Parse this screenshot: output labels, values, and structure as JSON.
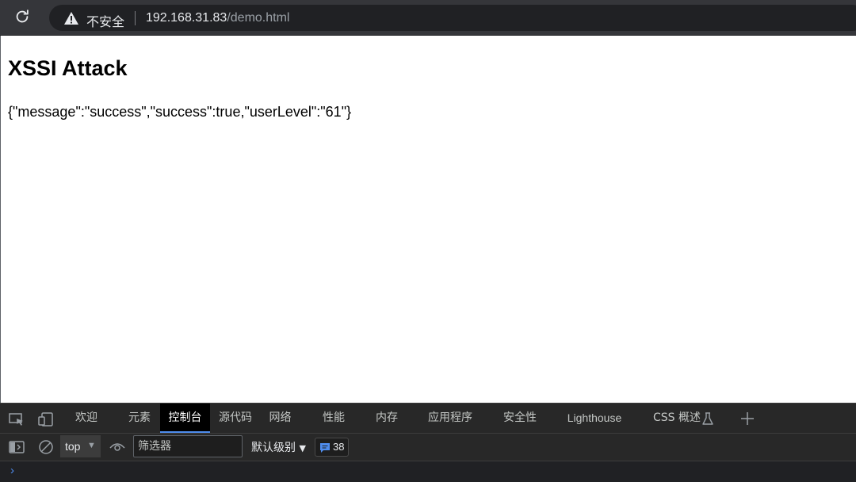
{
  "browser": {
    "security_label": "不安全",
    "url_host": "192.168.31.83",
    "url_path": "/demo.html"
  },
  "page": {
    "title": "XSSI Attack",
    "json_text": "{\"message\":\"success\",\"success\":true,\"userLevel\":\"61\"}"
  },
  "devtools": {
    "tabs": [
      "欢迎",
      "元素",
      "控制台",
      "源代码",
      "网络",
      "性能",
      "内存",
      "应用程序",
      "安全性",
      "Lighthouse",
      "CSS 概述"
    ],
    "active_tab": "控制台",
    "console": {
      "context": "top",
      "filter_placeholder": "筛选器",
      "level": "默认级别",
      "message_count": "38"
    }
  },
  "colors": {
    "toolbar_bg": "#35363a",
    "devtools_bg": "#282828",
    "accent": "#4f8dee"
  }
}
